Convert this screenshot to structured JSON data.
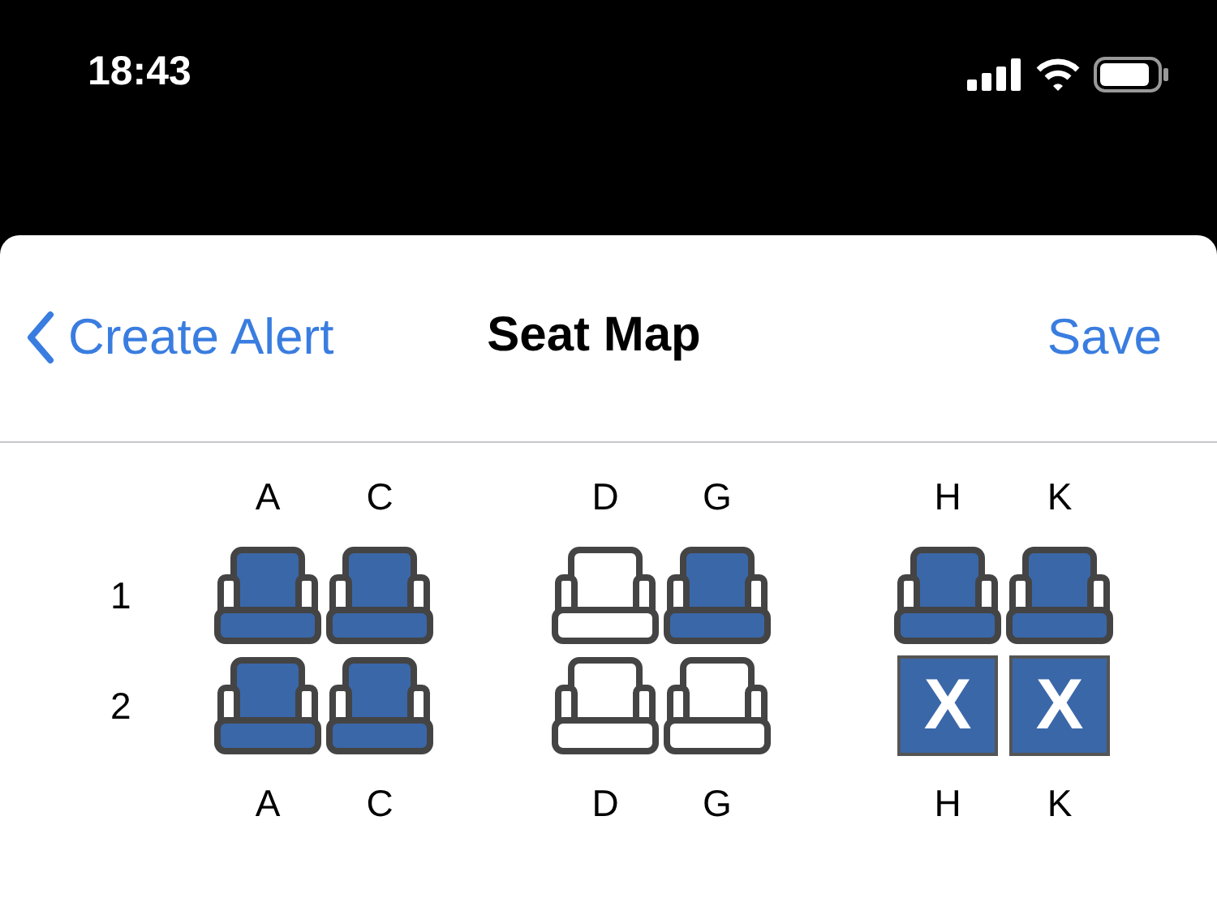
{
  "status_bar": {
    "time": "18:43"
  },
  "nav": {
    "back": "Create Alert",
    "title": "Seat Map",
    "action": "Save"
  },
  "seat_map": {
    "columns_top": [
      "A",
      "C",
      "D",
      "G",
      "H",
      "K"
    ],
    "rows": [
      {
        "label": "1",
        "seats": [
          {
            "kind": "occupied"
          },
          {
            "kind": "occupied"
          },
          {
            "kind": "available"
          },
          {
            "kind": "occupied"
          },
          {
            "kind": "occupied"
          },
          {
            "kind": "occupied"
          }
        ]
      },
      {
        "label": "2",
        "seats": [
          {
            "kind": "occupied"
          },
          {
            "kind": "occupied"
          },
          {
            "kind": "available"
          },
          {
            "kind": "available"
          },
          {
            "kind": "blocked",
            "mark": "X"
          },
          {
            "kind": "blocked",
            "mark": "X"
          }
        ]
      }
    ],
    "columns_bottom": [
      "A",
      "C",
      "D",
      "G",
      "H",
      "K"
    ]
  }
}
